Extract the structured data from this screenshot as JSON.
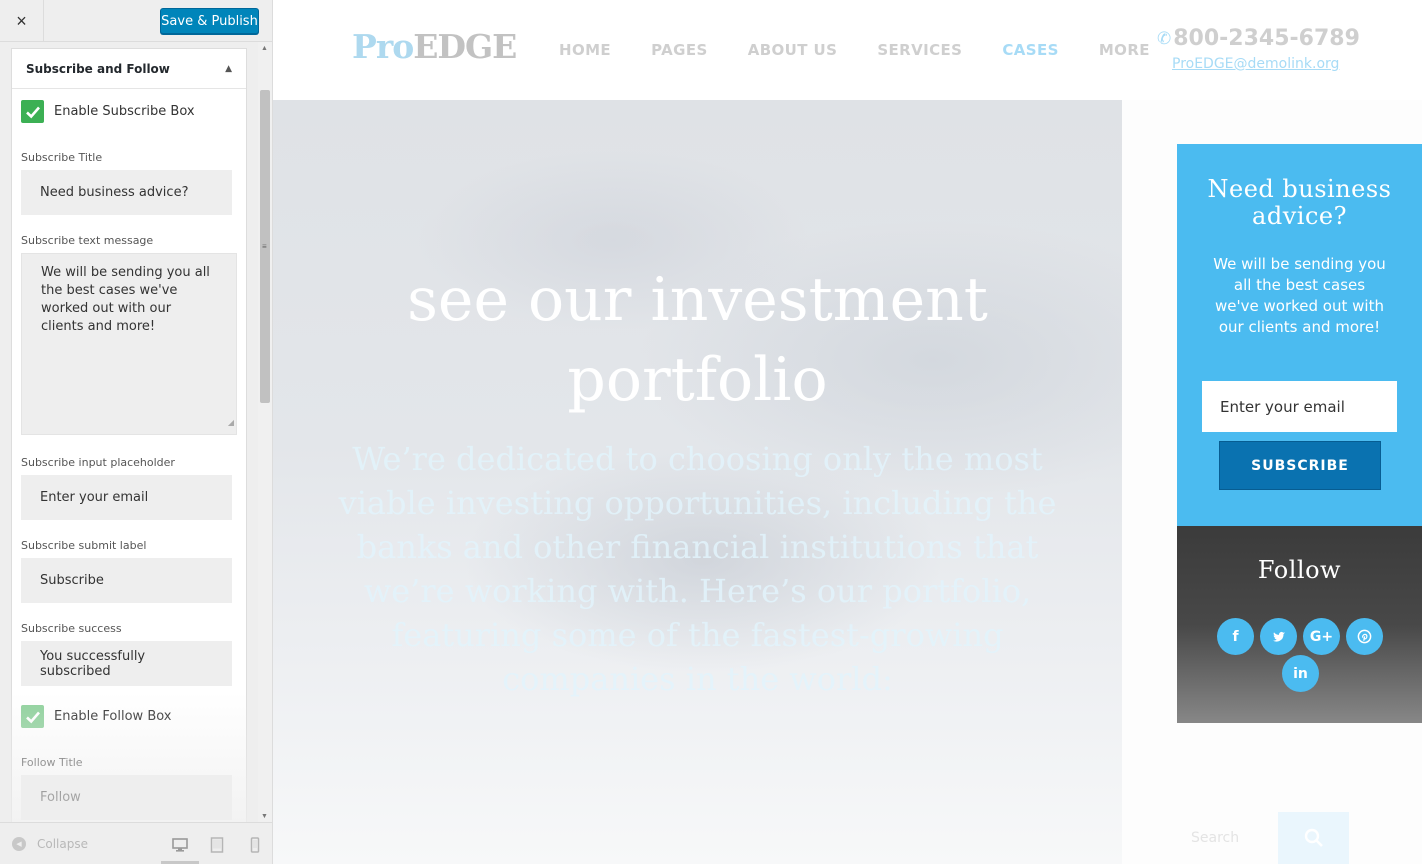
{
  "sidebar": {
    "close_label": "×",
    "save_label": "Save & Publish",
    "section_title": "Subscribe and Follow",
    "enable_subscribe_label": "Enable Subscribe Box",
    "subscribe_title_label": "Subscribe Title",
    "subscribe_title_value": "Need business advice?",
    "subscribe_text_label": "Subscribe text message",
    "subscribe_text_value": "We will be sending you all the best cases we've worked out with our clients and more!",
    "subscribe_placeholder_label": "Subscribe input placeholder",
    "subscribe_placeholder_value": "Enter your email",
    "subscribe_submit_label": "Subscribe submit label",
    "subscribe_submit_value": "Subscribe",
    "subscribe_success_label": "Subscribe success",
    "subscribe_success_value": "You successfully subscribed",
    "enable_follow_label": "Enable Follow Box",
    "follow_title_label": "Follow Title",
    "follow_title_value": "Follow",
    "collapse_label": "Collapse"
  },
  "site": {
    "logo_pro": "Pro",
    "logo_edge": "EDGE",
    "nav": [
      "HOME",
      "PAGES",
      "ABOUT US",
      "SERVICES",
      "CASES",
      "MORE"
    ],
    "active_nav": "CASES",
    "phone": "800-2345-6789",
    "email": "ProEDGE@demolink.org",
    "hero_title": "see our investment portfolio",
    "hero_text": "We’re dedicated to choosing only the most viable investing opportunities, including the banks and other financial institutions that we’re working with. Here’s our portfolio, featuring some of the fastest-growing companies in the world:",
    "subscribe": {
      "title": "Need business advice?",
      "text": "We will be sending you all the best cases we've worked out with our clients and more!",
      "placeholder": "Enter your email",
      "button": "SUBSCRIBE"
    },
    "follow": {
      "title": "Follow",
      "icons": [
        {
          "name": "facebook-icon",
          "glyph": "f"
        },
        {
          "name": "twitter-icon",
          "glyph": "🐦"
        },
        {
          "name": "google-plus-icon",
          "glyph": "G+"
        },
        {
          "name": "pinterest-icon",
          "glyph": "℗"
        },
        {
          "name": "linkedin-icon",
          "glyph": "in"
        }
      ]
    },
    "search_placeholder": "Search"
  },
  "colors": {
    "accent_blue": "#4bbbf0",
    "button_blue": "#0a72b0",
    "checkbox_green": "#3cb054",
    "publish_blue": "#0085ba"
  }
}
